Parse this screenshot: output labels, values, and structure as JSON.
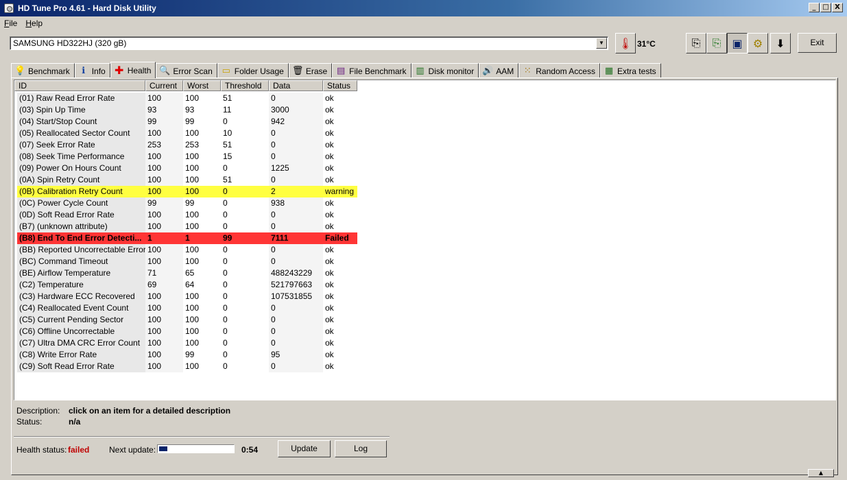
{
  "window": {
    "title": "HD Tune Pro 4.61 - Hard Disk Utility",
    "buttons": [
      "_",
      "□",
      "X"
    ]
  },
  "menu": [
    {
      "first": "F",
      "rest": "ile"
    },
    {
      "first": "H",
      "rest": "elp"
    }
  ],
  "drive": {
    "selected": "SAMSUNG HD322HJ (320 gB)"
  },
  "temperature": "31°C",
  "exit_label": "Exit",
  "tabs": [
    {
      "label": "Benchmark",
      "icon": "lightbulb-icon"
    },
    {
      "label": "Info",
      "icon": "info-icon"
    },
    {
      "label": "Health",
      "icon": "red-cross-icon",
      "active": true
    },
    {
      "label": "Error Scan",
      "icon": "magnifier-icon"
    },
    {
      "label": "Folder Usage",
      "icon": "folder-icon"
    },
    {
      "label": "Erase",
      "icon": "trash-icon"
    },
    {
      "label": "File Benchmark",
      "icon": "file-bulb-icon"
    },
    {
      "label": "Disk monitor",
      "icon": "bar-chart-icon"
    },
    {
      "label": "AAM",
      "icon": "speaker-icon"
    },
    {
      "label": "Random Access",
      "icon": "dots-grid-icon"
    },
    {
      "label": "Extra tests",
      "icon": "chart-grid-icon"
    }
  ],
  "columns": [
    "ID",
    "Current",
    "Worst",
    "Threshold",
    "Data",
    "Status"
  ],
  "rows": [
    [
      "(01) Raw Read Error Rate",
      "100",
      "100",
      "51",
      "0",
      "ok"
    ],
    [
      "(03) Spin Up Time",
      "93",
      "93",
      "11",
      "3000",
      "ok"
    ],
    [
      "(04) Start/Stop Count",
      "99",
      "99",
      "0",
      "942",
      "ok"
    ],
    [
      "(05) Reallocated Sector Count",
      "100",
      "100",
      "10",
      "0",
      "ok"
    ],
    [
      "(07) Seek Error Rate",
      "253",
      "253",
      "51",
      "0",
      "ok"
    ],
    [
      "(08) Seek Time Performance",
      "100",
      "100",
      "15",
      "0",
      "ok"
    ],
    [
      "(09) Power On Hours Count",
      "100",
      "100",
      "0",
      "1225",
      "ok"
    ],
    [
      "(0A) Spin Retry Count",
      "100",
      "100",
      "51",
      "0",
      "ok"
    ],
    [
      "(0B) Calibration Retry Count",
      "100",
      "100",
      "0",
      "2",
      "warning"
    ],
    [
      "(0C) Power Cycle Count",
      "99",
      "99",
      "0",
      "938",
      "ok"
    ],
    [
      "(0D) Soft Read Error Rate",
      "100",
      "100",
      "0",
      "0",
      "ok"
    ],
    [
      "(B7) (unknown attribute)",
      "100",
      "100",
      "0",
      "0",
      "ok"
    ],
    [
      "(B8) End To End Error Detecti...",
      "1",
      "1",
      "99",
      "7111",
      "Failed"
    ],
    [
      "(BB) Reported Uncorrectable Errors",
      "100",
      "100",
      "0",
      "0",
      "ok"
    ],
    [
      "(BC) Command Timeout",
      "100",
      "100",
      "0",
      "0",
      "ok"
    ],
    [
      "(BE) Airflow Temperature",
      "71",
      "65",
      "0",
      "488243229",
      "ok"
    ],
    [
      "(C2) Temperature",
      "69",
      "64",
      "0",
      "521797663",
      "ok"
    ],
    [
      "(C3) Hardware ECC Recovered",
      "100",
      "100",
      "0",
      "107531855",
      "ok"
    ],
    [
      "(C4) Reallocated Event Count",
      "100",
      "100",
      "0",
      "0",
      "ok"
    ],
    [
      "(C5) Current Pending Sector",
      "100",
      "100",
      "0",
      "0",
      "ok"
    ],
    [
      "(C6) Offline Uncorrectable",
      "100",
      "100",
      "0",
      "0",
      "ok"
    ],
    [
      "(C7) Ultra DMA CRC Error Count",
      "100",
      "100",
      "0",
      "0",
      "ok"
    ],
    [
      "(C8) Write Error Rate",
      "100",
      "99",
      "0",
      "95",
      "ok"
    ],
    [
      "(C9) Soft Read Error Rate",
      "100",
      "100",
      "0",
      "0",
      "ok"
    ]
  ],
  "description": {
    "label": "Description:",
    "value": "click on an item for a detailed description"
  },
  "status": {
    "label": "Status:",
    "value": "n/a"
  },
  "health": {
    "label": "Health status:",
    "value": "failed"
  },
  "next_update": {
    "label": "Next update:",
    "countdown": "0:54",
    "progress": 0.11
  },
  "buttons": {
    "update": "Update",
    "log": "Log"
  },
  "colors": {
    "warning_row": "#ffff40",
    "failed_row": "#ff3535",
    "health_failed": "#c00000",
    "titlebar": "#0a246a"
  }
}
